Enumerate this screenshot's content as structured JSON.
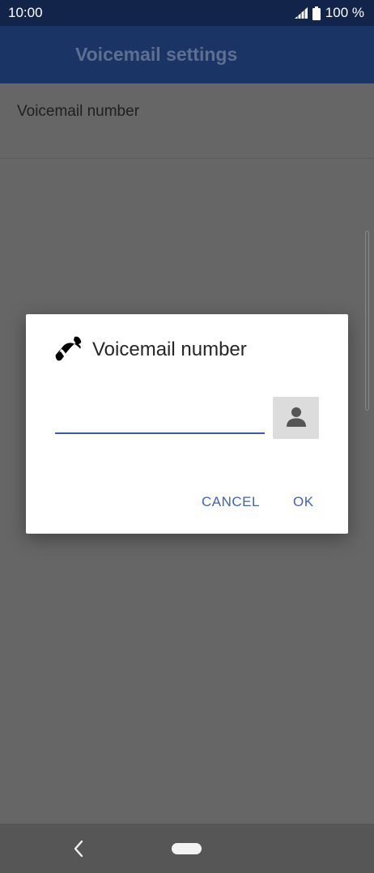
{
  "status_bar": {
    "time": "10:00",
    "battery": "100 %",
    "icons": [
      "signal-icon",
      "battery-icon"
    ]
  },
  "app_bar": {
    "title": "Voicemail settings"
  },
  "settings": {
    "items": [
      {
        "label": "Voicemail number"
      }
    ]
  },
  "dialog": {
    "icon": "phone-icon",
    "title": "Voicemail number",
    "input_value": "",
    "contact_icon": "contact-icon",
    "cancel_label": "CANCEL",
    "ok_label": "OK"
  },
  "nav_bar": {
    "icons": [
      "back-icon",
      "home-icon"
    ]
  },
  "colors": {
    "status_bar": "#13244a",
    "app_bar": "#1a3466",
    "accent": "#3f63b6",
    "scrim_background": "#666666"
  }
}
